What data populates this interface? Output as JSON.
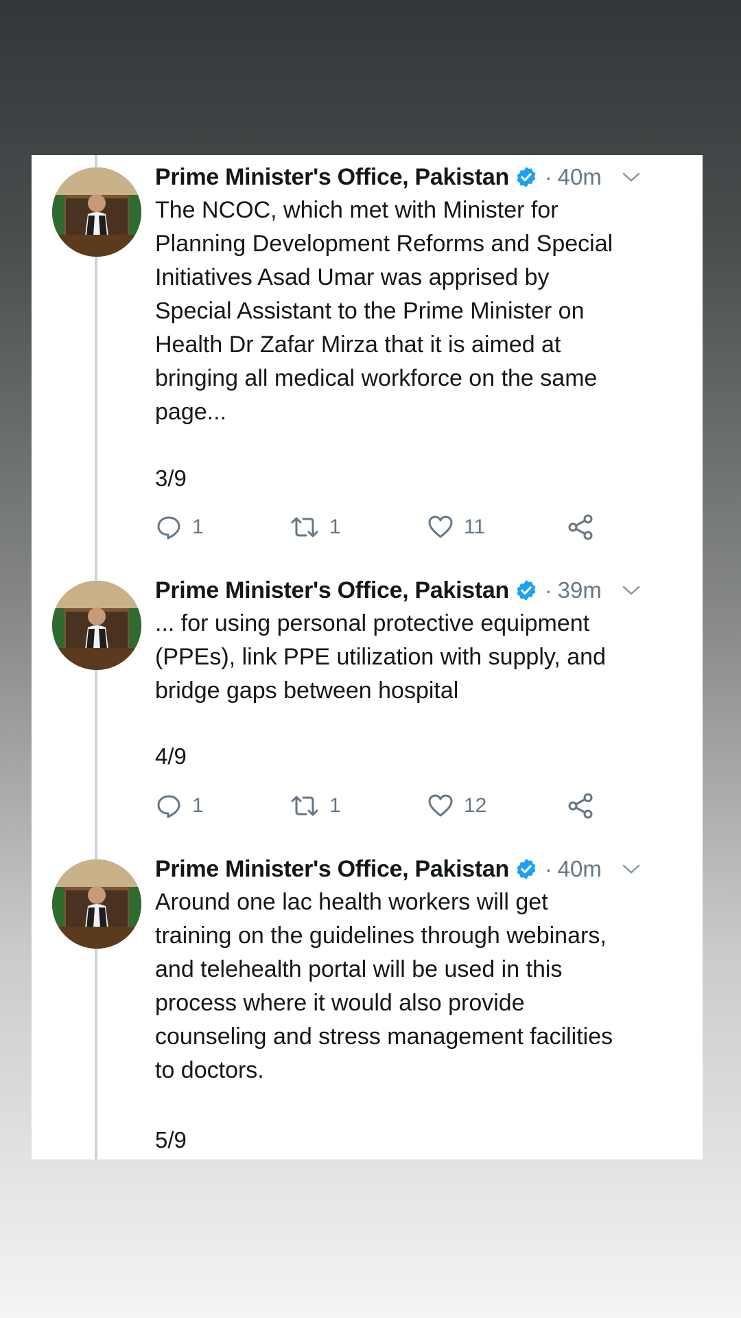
{
  "tweets": [
    {
      "author": "Prime Minister's Office, Pakistan",
      "time": "40m",
      "text": "The NCOC, which met with Minister for\nPlanning Development Reforms and Special\nInitiatives Asad Umar was apprised by\nSpecial Assistant to the Prime Minister on\nHealth Dr Zafar Mirza that it is aimed at\nbringing all medical workforce on the same\npage...",
      "counter": "3/9",
      "replies": "1",
      "retweets": "1",
      "likes": "11"
    },
    {
      "author": "Prime Minister's Office, Pakistan",
      "time": "39m",
      "text": "... for using personal protective equipment\n(PPEs), link PPE utilization with supply, and\nbridge gaps between hospital",
      "counter": "4/9",
      "replies": "1",
      "retweets": "1",
      "likes": "12"
    },
    {
      "author": "Prime Minister's Office, Pakistan",
      "time": "40m",
      "text": "Around one lac health workers will get\ntraining on the guidelines through webinars,\nand telehealth portal will be used in this\nprocess where it would also provide\ncounseling and stress management facilities\nto doctors.",
      "counter": "5/9"
    }
  ],
  "icons": {
    "verified": "verified-badge-icon",
    "menu": "chevron-down-icon",
    "reply": "reply-icon",
    "retweet": "retweet-icon",
    "like": "heart-icon",
    "share": "share-icon"
  },
  "colors": {
    "verified": "#1da1f2",
    "text": "#14171a",
    "muted": "#657786",
    "thread_line": "#c9d3dc"
  }
}
